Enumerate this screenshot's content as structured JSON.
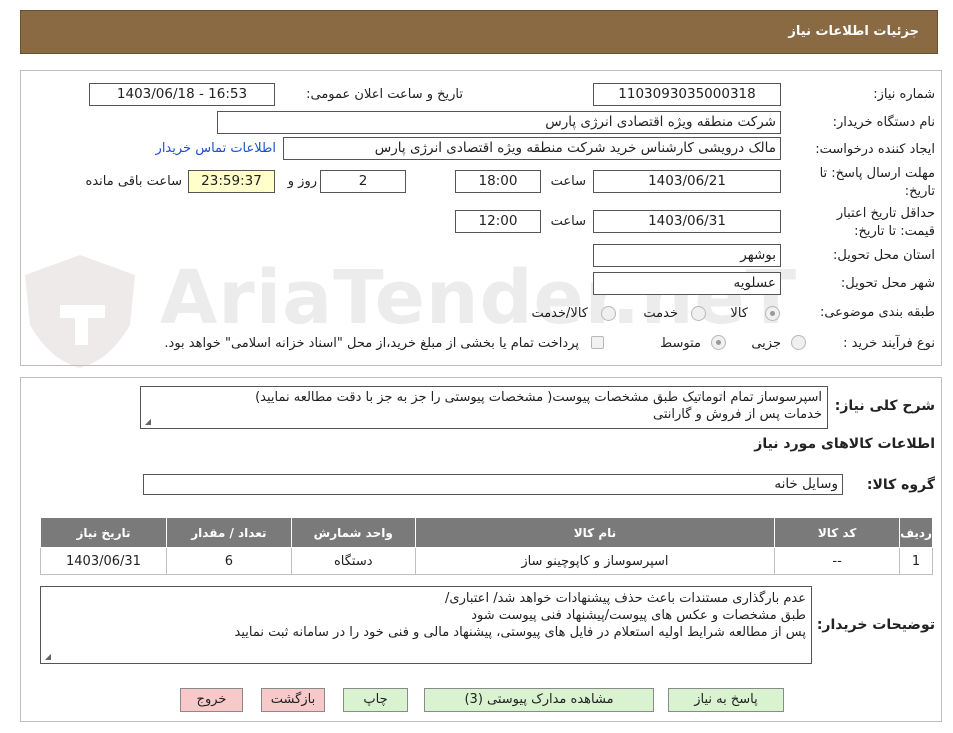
{
  "header": {
    "title": "جزئیات اطلاعات نیاز"
  },
  "form": {
    "need_number": {
      "label": "شماره نیاز:",
      "value": "1103093035000318"
    },
    "announce": {
      "label": "تاریخ و ساعت اعلان عمومی:",
      "value": "1403/06/18 - 16:53"
    },
    "buyer_org": {
      "label": "نام دستگاه خریدار:",
      "value": "شرکت منطقه ویژه اقتصادی انرژی پارس"
    },
    "requester": {
      "label": "ایجاد کننده درخواست:",
      "value": "مالک  درویشی کارشناس خرید شرکت منطقه ویژه اقتصادی انرژی پارس",
      "contact_link": "اطلاعات تماس خریدار"
    },
    "reply_deadline": {
      "label_line1": "مهلت ارسال پاسخ: تا",
      "label_line2": "تاریخ:",
      "date": "1403/06/21",
      "time_label": "ساعت",
      "time": "18:00",
      "days": "2",
      "days_label": "روز و",
      "remaining": "23:59:37",
      "remaining_label": "ساعت باقی مانده"
    },
    "price_validity": {
      "label_line1": "حداقل تاریخ اعتبار",
      "label_line2": "قیمت: تا تاریخ:",
      "date": "1403/06/31",
      "time_label": "ساعت",
      "time": "12:00"
    },
    "province": {
      "label": "استان محل تحویل:",
      "value": "بوشهر"
    },
    "city": {
      "label": "شهر محل تحویل:",
      "value": "عسلویه"
    },
    "category": {
      "label": "طبقه بندی موضوعی:",
      "options": [
        "کالا",
        "خدمت",
        "کالا/خدمت"
      ],
      "selected": "کالا"
    },
    "process": {
      "label": "نوع فرآیند خرید :",
      "options": [
        "جزیی",
        "متوسط"
      ],
      "selected": "متوسط",
      "payment_note": "پرداخت تمام یا بخشی از مبلغ خرید،از محل \"اسناد خزانه اسلامی\" خواهد بود."
    }
  },
  "desc": {
    "label": "شرح کلی نیاز:",
    "line1": "اسپرسوساز تمام اتوماتیک طبق مشخصات پیوست( مشخصات پیوستی را جز به جز  با دقت مطالعه نمایید)",
    "line2": "خدمات پس از فروش و گارانتی"
  },
  "goods_info_title": "اطلاعات کالاهای مورد نیاز",
  "goods_group": {
    "label": "گروه کالا:",
    "value": "وسایل خانه"
  },
  "table": {
    "headers": [
      "ردیف",
      "کد کالا",
      "نام کالا",
      "واحد شمارش",
      "تعداد / مقدار",
      "تاریخ نیاز"
    ],
    "rows": [
      [
        "1",
        "--",
        "اسپرسوساز و کاپوچینو ساز",
        "دستگاه",
        "6",
        "1403/06/31"
      ]
    ]
  },
  "buyer_notes": {
    "label": "توضیحات خریدار:",
    "line1": "عدم بارگذاری مستندات باعث حذف پیشنهادات خواهد شد/ اعتباری/",
    "line2": "طبق مشخصات و عکس های پیوست/پیشنهاد فنی پیوست شود",
    "line3": "پس از مطالعه شرایط اولیه استعلام در فایل های پیوستی، پیشنهاد مالی و فنی خود را در سامانه ثبت نمایید"
  },
  "buttons": {
    "reply": "پاسخ به نیاز",
    "attachments": "مشاهده مدارک پیوستی (3)",
    "print": "چاپ",
    "back": "بازگشت",
    "exit": "خروج"
  },
  "watermark": "AriaTender.neT",
  "colors": {
    "header_bg": "#8a6a42",
    "table_header": "#7a7a7a",
    "button_green": "#d9f2cf",
    "button_red": "#f8c9c9",
    "link": "#1a50c8"
  }
}
